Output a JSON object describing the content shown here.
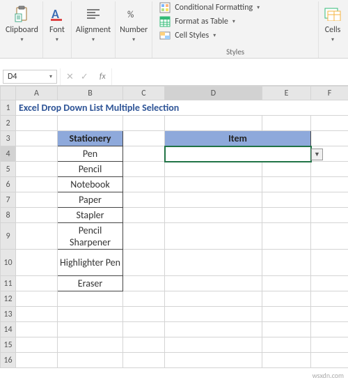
{
  "ribbon": {
    "clipboard": {
      "label": "Clipboard"
    },
    "font": {
      "label": "Font"
    },
    "alignment": {
      "label": "Alignment"
    },
    "number": {
      "label": "Number"
    },
    "styles": {
      "label": "Styles",
      "cond_fmt": "Conditional Formatting",
      "as_table": "Format as Table",
      "cell_styles": "Cell Styles"
    },
    "cells": {
      "label": "Cells"
    }
  },
  "name_box": {
    "value": "D4"
  },
  "formula_bar": {
    "value": ""
  },
  "columns": [
    "A",
    "B",
    "C",
    "D",
    "E",
    "F"
  ],
  "rows": [
    "1",
    "2",
    "3",
    "4",
    "5",
    "6",
    "7",
    "8",
    "9",
    "10",
    "11",
    "12",
    "13",
    "14",
    "15",
    "16"
  ],
  "sheet": {
    "title": "Excel Drop Down List Multiple Selection",
    "stationery_header": "Stationery",
    "item_header": "Item",
    "stationery": [
      "Pen",
      "Pencil",
      "Notebook",
      "Paper",
      "Stapler",
      "Pencil Sharpener",
      "Highlighter Pen",
      "Eraser"
    ]
  },
  "active_cell": "D4",
  "colors": {
    "header_fill": "#8ea9db",
    "selection": "#217346",
    "title": "#2f5597"
  },
  "watermark": "wsxdn.com"
}
